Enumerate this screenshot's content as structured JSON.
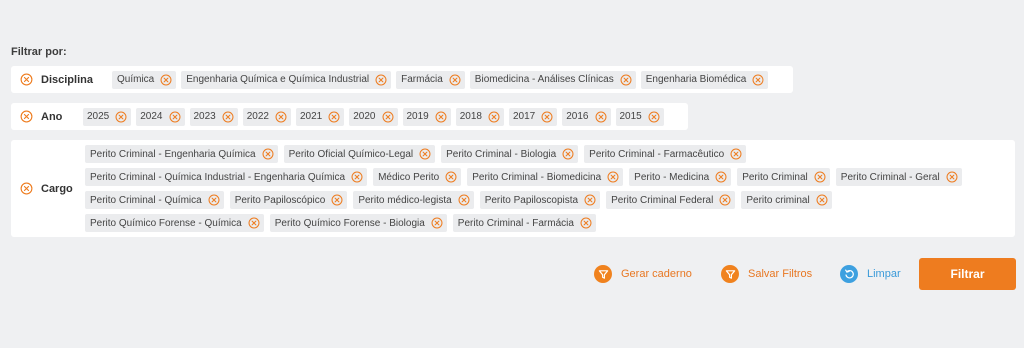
{
  "filter_heading": "Filtrar por:",
  "colors": {
    "accent": "#ee7c1f",
    "link_blue": "#3da0e0",
    "chip_bg": "#ebecee",
    "panel_bg": "#ffffff",
    "page_bg": "#eff0f2"
  },
  "groups": {
    "disciplina": {
      "label": "Disciplina",
      "chips": [
        "Química",
        "Engenharia Química e Química Industrial",
        "Farmácia",
        "Biomedicina - Análises Clínicas",
        "Engenharia Biomédica"
      ]
    },
    "ano": {
      "label": "Ano",
      "chips": [
        "2025",
        "2024",
        "2023",
        "2022",
        "2021",
        "2020",
        "2019",
        "2018",
        "2017",
        "2016",
        "2015"
      ]
    },
    "cargo": {
      "label": "Cargo",
      "chips": [
        "Perito Criminal - Engenharia Química",
        "Perito Oficial Químico-Legal",
        "Perito Criminal - Biologia",
        "Perito Criminal - Farmacêutico",
        "Perito Criminal - Química Industrial - Engenharia Química",
        "Médico Perito",
        "Perito Criminal - Biomedicina",
        "Perito - Medicina",
        "Perito Criminal",
        "Perito Criminal - Geral",
        "Perito Criminal - Química",
        "Perito Papiloscópico",
        "Perito médico-legista",
        "Perito Papiloscopista",
        "Perito Criminal Federal",
        "Perito criminal",
        "Perito Químico Forense - Química",
        "Perito Químico Forense - Biologia",
        "Perito Criminal - Farmácia"
      ]
    }
  },
  "actions": {
    "gerar_label": "Gerar caderno",
    "gerar_icon": "filter-icon",
    "salvar_label": "Salvar Filtros",
    "salvar_icon": "filter-icon",
    "limpar_label": "Limpar",
    "limpar_icon": "refresh-icon",
    "filtrar_label": "Filtrar"
  }
}
